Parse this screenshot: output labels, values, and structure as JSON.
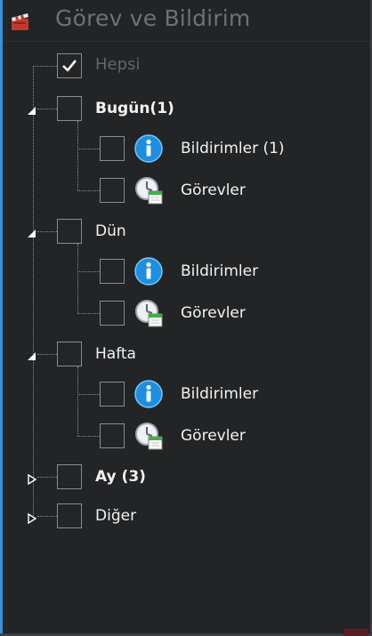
{
  "header": {
    "title": "Görev ve Bildirim",
    "icon": "clapperboard-icon"
  },
  "tree": {
    "root": {
      "label": "Hepsi",
      "checked": true
    },
    "groups": [
      {
        "label": "Bugün(1)",
        "bold": true,
        "expanded": true,
        "children": [
          {
            "label": "Bildirimler (1)",
            "icon": "info-icon"
          },
          {
            "label": "Görevler",
            "icon": "task-clock-icon"
          }
        ]
      },
      {
        "label": "Dün",
        "bold": false,
        "expanded": true,
        "children": [
          {
            "label": "Bildirimler",
            "icon": "info-icon"
          },
          {
            "label": "Görevler",
            "icon": "task-clock-icon"
          }
        ]
      },
      {
        "label": "Hafta",
        "bold": false,
        "expanded": true,
        "children": [
          {
            "label": "Bildirimler",
            "icon": "info-icon"
          },
          {
            "label": "Görevler",
            "icon": "task-clock-icon"
          }
        ]
      },
      {
        "label": "Ay (3)",
        "bold": true,
        "expanded": false
      },
      {
        "label": "Diğer",
        "bold": false,
        "expanded": false
      }
    ]
  },
  "colors": {
    "background": "#222426",
    "accent": "#3a8fd8",
    "text": "#f2f2f2",
    "muted_text": "#62666a",
    "info_blue": "#1e8fe0"
  }
}
